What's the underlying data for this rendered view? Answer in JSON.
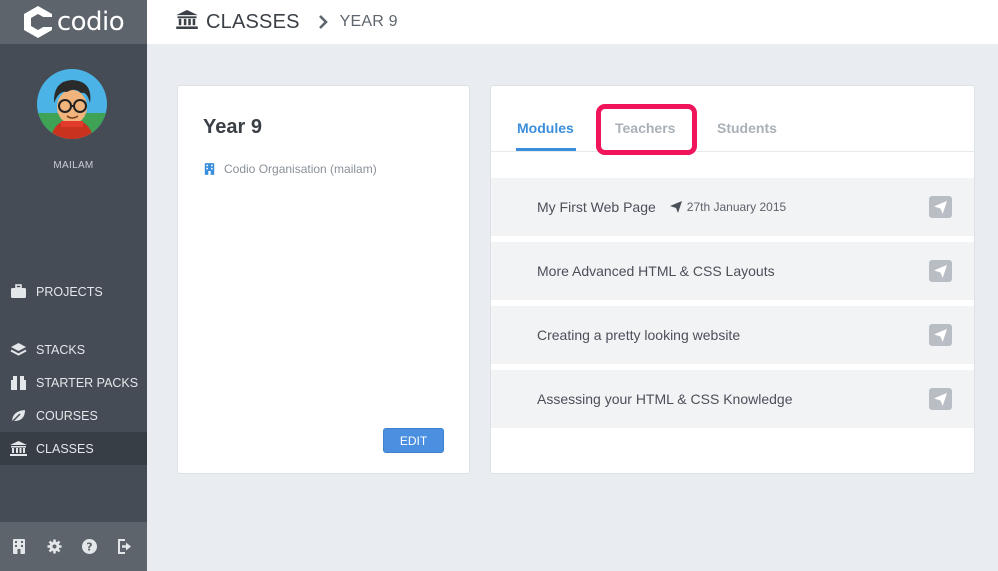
{
  "app": {
    "logo_text": "codio"
  },
  "sidebar": {
    "username": "MAILAM",
    "items": [
      {
        "label": "PROJECTS",
        "icon": "briefcase-icon"
      },
      {
        "label": "STACKS",
        "icon": "layers-icon"
      },
      {
        "label": "STARTER PACKS",
        "icon": "package-icon"
      },
      {
        "label": "COURSES",
        "icon": "leaf-icon"
      },
      {
        "label": "CLASSES",
        "icon": "institution-icon",
        "active": true
      }
    ],
    "footer_icons": [
      "building-icon",
      "gear-icon",
      "help-icon",
      "logout-icon"
    ]
  },
  "breadcrumb": {
    "root": "CLASSES",
    "leaf": "YEAR 9"
  },
  "class_card": {
    "title": "Year 9",
    "organisation": "Codio Organisation (mailam)",
    "edit_label": "EDIT"
  },
  "tabs": [
    {
      "label": "Modules",
      "active": true
    },
    {
      "label": "Teachers",
      "highlighted": true
    },
    {
      "label": "Students"
    }
  ],
  "modules": [
    {
      "name": "My First Web Page",
      "date": "27th January 2015"
    },
    {
      "name": "More Advanced HTML & CSS Layouts"
    },
    {
      "name": "Creating a pretty looking website"
    },
    {
      "name": "Assessing your HTML & CSS Knowledge"
    }
  ],
  "colors": {
    "sidebar": "#454c55",
    "accent": "#3a8fdc",
    "edit_button": "#4a8fe0",
    "highlight": "#f0145a"
  }
}
